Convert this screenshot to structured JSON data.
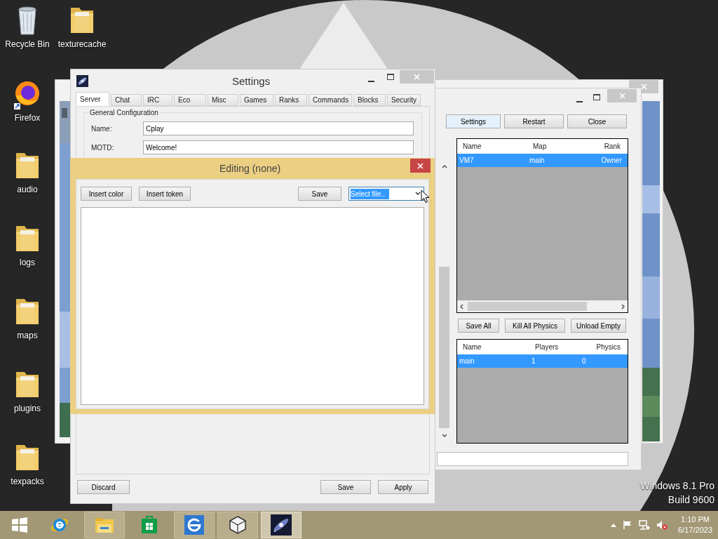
{
  "desktop_icons": [
    {
      "label": "Recycle Bin",
      "kind": "bin"
    },
    {
      "label": "texturecache",
      "kind": "folder"
    },
    {
      "label": "Firefox",
      "kind": "firefox"
    },
    {
      "label": "audio",
      "kind": "folder"
    },
    {
      "label": "logs",
      "kind": "folder"
    },
    {
      "label": "maps",
      "kind": "folder"
    },
    {
      "label": "plugins",
      "kind": "folder"
    },
    {
      "label": "texpacks",
      "kind": "folder"
    }
  ],
  "server_window": {
    "buttons": [
      {
        "label": "Settings",
        "focused": true
      },
      {
        "label": "Restart",
        "focused": false
      },
      {
        "label": "Close",
        "focused": false
      }
    ],
    "players": {
      "columns": [
        "Name",
        "Map",
        "Rank"
      ],
      "rows": [
        {
          "cells": [
            "VM7",
            "main",
            "Owner"
          ],
          "selected": true
        }
      ]
    },
    "map_buttons": [
      "Save All",
      "Kill All Physics",
      "Unload Empty"
    ],
    "maps": {
      "columns": [
        "Name",
        "Players",
        "Physics"
      ],
      "rows": [
        {
          "cells": [
            "main",
            "1",
            "0"
          ],
          "selected": true
        }
      ]
    }
  },
  "settings_window": {
    "title": "Settings",
    "tabs": [
      {
        "label": "Server",
        "selected": true
      },
      {
        "label": "Chat",
        "selected": false
      },
      {
        "label": "IRC",
        "selected": false
      },
      {
        "label": "Eco",
        "selected": false
      },
      {
        "label": "Misc",
        "selected": false
      },
      {
        "label": "Games",
        "selected": false
      },
      {
        "label": "Ranks",
        "selected": false
      },
      {
        "label": "Commands",
        "selected": false
      },
      {
        "label": "Blocks",
        "selected": false
      },
      {
        "label": "Security",
        "selected": false
      }
    ],
    "group_title": "General Configuration",
    "fields": [
      {
        "label": "Name:",
        "value": "Cplay"
      },
      {
        "label": "MOTD:",
        "value": "Welcome!"
      }
    ],
    "buttons": [
      "Discard",
      "Save",
      "Apply"
    ]
  },
  "editor_dialog": {
    "title": "Editing (none)",
    "buttons": [
      "Insert color",
      "Insert token",
      "Save"
    ],
    "file_select": {
      "value": "Select file..",
      "highlighted": true
    }
  },
  "os_edition": [
    "Windows 8.1 Pro",
    "Build 9600"
  ],
  "taskbar": {
    "items": [
      {
        "kind": "start",
        "running": false,
        "selected": false
      },
      {
        "kind": "ie",
        "running": false,
        "selected": false
      },
      {
        "kind": "explorer",
        "running": true,
        "selected": false
      },
      {
        "kind": "store",
        "running": false,
        "selected": false
      },
      {
        "kind": "ie-tile",
        "running": true,
        "selected": false
      },
      {
        "kind": "cube",
        "running": true,
        "selected": false
      },
      {
        "kind": "galaxy",
        "running": true,
        "selected": true
      }
    ],
    "time": "1:10 PM",
    "date": "6/17/2023"
  }
}
